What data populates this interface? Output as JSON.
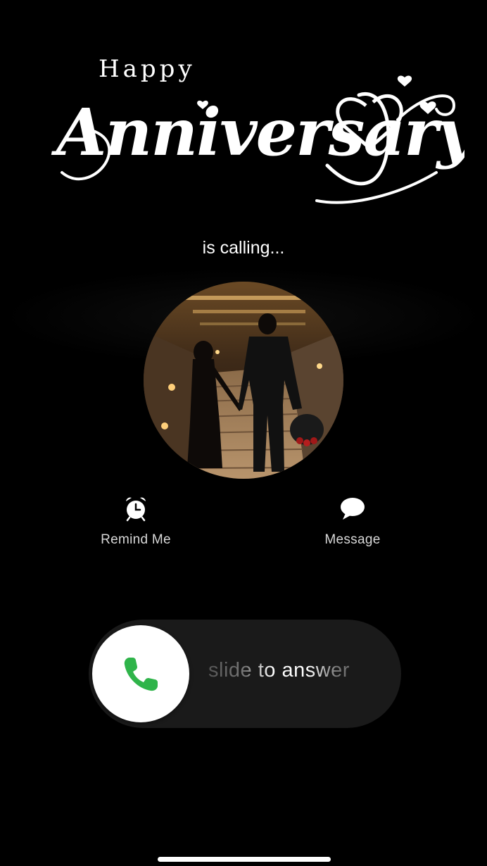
{
  "header": {
    "happy_text": "Happy",
    "script_text": "Anniversary"
  },
  "call": {
    "status_text": "is calling..."
  },
  "actions": [
    {
      "label": "Remind Me",
      "icon": "alarm-clock-icon"
    },
    {
      "label": "Message",
      "icon": "message-bubble-icon"
    }
  ],
  "slider": {
    "text": "slide to answer",
    "icon": "phone-icon",
    "accent": "#2fb44a"
  },
  "colors": {
    "background": "#000000",
    "text": "#ffffff",
    "accept_green": "#2fb44a"
  }
}
